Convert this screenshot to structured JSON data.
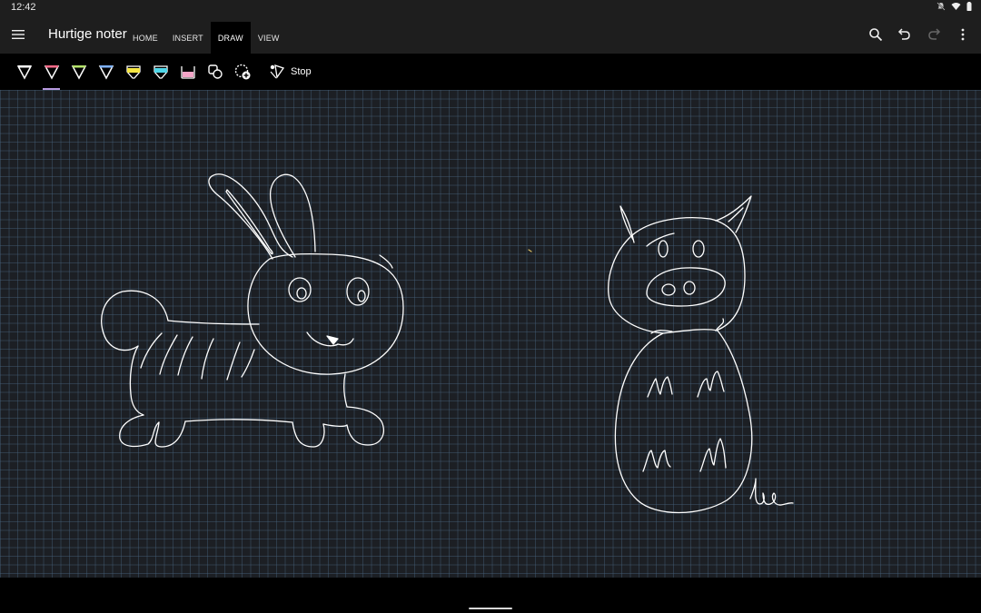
{
  "status": {
    "time": "12:42"
  },
  "app": {
    "title": "Hurtige noter"
  },
  "tabs": [
    {
      "label": "HOME"
    },
    {
      "label": "INSERT"
    },
    {
      "label": "DRAW"
    },
    {
      "label": "VIEW"
    }
  ],
  "active_tab": "DRAW",
  "actions": [
    "search-icon",
    "undo-icon",
    "redo-icon",
    "more-icon"
  ],
  "toolbar": {
    "pens": [
      {
        "icon": "pen-icon",
        "color": "#ffffff"
      },
      {
        "icon": "pen-icon",
        "color": "#ff6b8a"
      },
      {
        "icon": "pen-icon",
        "color": "#b5e36a"
      },
      {
        "icon": "pen-icon",
        "color": "#7fb2ff"
      },
      {
        "icon": "highlighter-icon",
        "color": "#f5e642"
      },
      {
        "icon": "highlighter-icon",
        "color": "#4fd6e8"
      },
      {
        "icon": "highlighter-icon",
        "color": "#f4a6c8"
      }
    ],
    "selected_pen_index": 1,
    "shapes_icon": "shapes-icon",
    "add_pen_icon": "add-pen-icon",
    "stop_label": "Stop"
  },
  "colors": {
    "bar_bg": "#1e1e1e",
    "canvas_bg": "#1c1f24",
    "ink": "#ffffff",
    "accent": "#b89ae0"
  }
}
